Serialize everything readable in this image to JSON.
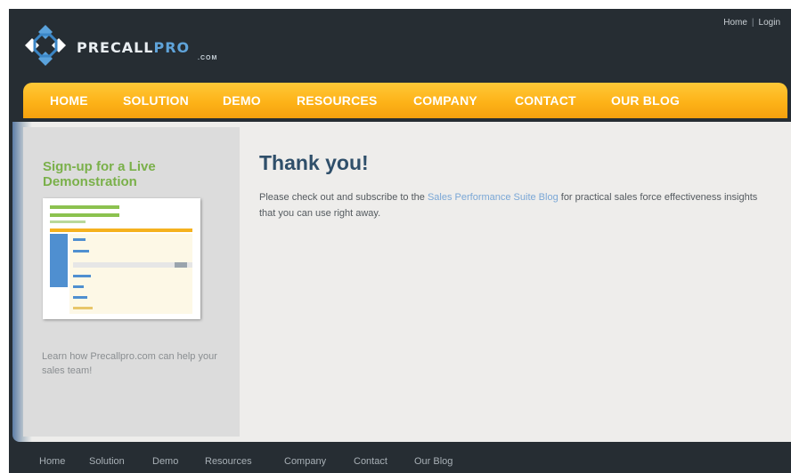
{
  "header": {
    "brand_main": "PRECALL",
    "brand_accent": "PRO",
    "brand_sub": ".COM",
    "top_links": [
      "Home",
      "Login"
    ],
    "top_separator": "|"
  },
  "nav": {
    "items": [
      "HOME",
      "SOLUTION",
      "DEMO",
      "RESOURCES",
      "COMPANY",
      "CONTACT",
      "OUR BLOG"
    ]
  },
  "sidebar": {
    "title": "Sign-up for a Live Demonstration",
    "note": "Learn how Precallpro.com can help your sales team!"
  },
  "main": {
    "title": "Thank you!",
    "text_before": "Please check out and subscribe to the ",
    "link_text": "Sales Performance Suite Blog",
    "text_after": " for practical sales force effectiveness insights that you can use right away."
  },
  "footer": {
    "links": [
      "Home",
      "Solution",
      "Demo",
      "Resources",
      "Company",
      "Contact",
      "Our Blog"
    ]
  },
  "colors": {
    "header_bg": "#262d33",
    "nav_orange": "#fdb318",
    "sidebar_green": "#7ab04a",
    "title_blue": "#2f4f6a",
    "link_blue": "#7aa7d6"
  },
  "icons": [
    "precallpro-logo-icon",
    "demo-screenshot-thumbnail"
  ]
}
